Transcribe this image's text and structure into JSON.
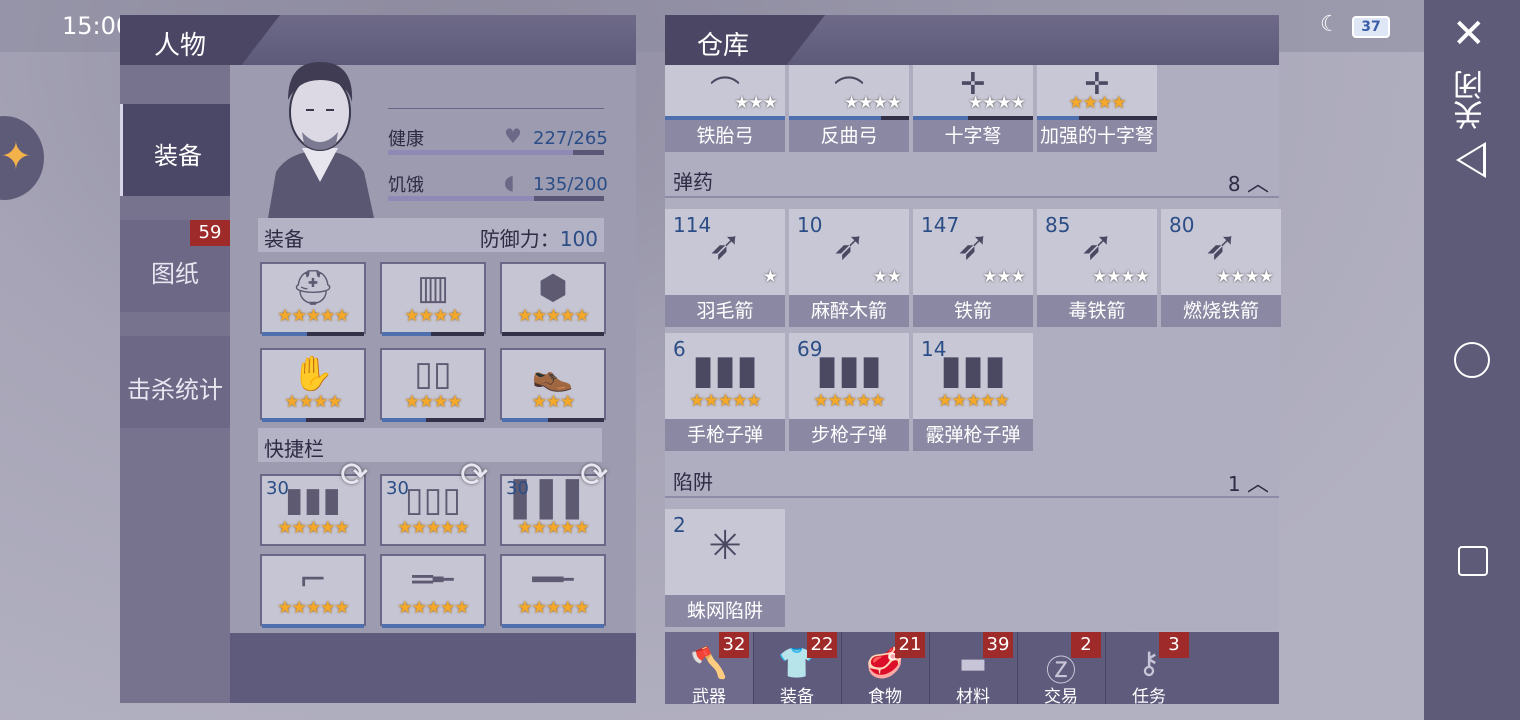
{
  "statusbar": {
    "time": "15:00",
    "battery": "37"
  },
  "system_rail": {
    "close_label": "关闭"
  },
  "left_header": {
    "title": "人物"
  },
  "right_header": {
    "title": "仓库"
  },
  "side_tabs": [
    {
      "label": "装备",
      "active": true
    },
    {
      "label": "图纸",
      "badge": "59"
    },
    {
      "label": "击杀统计"
    }
  ],
  "character": {
    "health_label": "健康",
    "health_value": "227/265",
    "health_fraction": 0.857,
    "hunger_label": "饥饿",
    "hunger_value": "135/200",
    "hunger_fraction": 0.675
  },
  "equipment": {
    "title": "装备",
    "defense_label": "防御力：",
    "defense_value": "100",
    "slots": [
      {
        "icon": "helmet-icon",
        "stars": "★★★★★",
        "durability": 0.44
      },
      {
        "icon": "chest-armor-icon",
        "stars": "★★★★",
        "durability": 0.48
      },
      {
        "icon": "turtle-shell-icon",
        "stars": "★★★★★",
        "durability": 0.0
      },
      {
        "icon": "gloves-icon",
        "stars": "★★★★",
        "durability": 0.43
      },
      {
        "icon": "pants-icon",
        "stars": "★★★★",
        "durability": 0.43
      },
      {
        "icon": "boots-icon",
        "stars": "★★★",
        "durability": 0.45
      }
    ]
  },
  "quickbar": {
    "title": "快捷栏",
    "slots": [
      {
        "icon": "pistol-ammo-icon",
        "qty": "30",
        "stars": "★★★★★"
      },
      {
        "icon": "shotgun-shells-icon",
        "qty": "30",
        "stars": "★★★★★"
      },
      {
        "icon": "rifle-ammo-icon",
        "qty": "30",
        "stars": "★★★★★"
      },
      {
        "icon": "revolver-icon",
        "stars": "★★★★★",
        "durability": 1.0
      },
      {
        "icon": "shotgun-icon",
        "stars": "★★★★★",
        "durability": 1.0
      },
      {
        "icon": "rifle-icon",
        "stars": "★★★★★",
        "durability": 1.0
      }
    ]
  },
  "warehouse": {
    "weapons": [
      {
        "name": "铁胎弓",
        "stars": "★★★",
        "gold": false,
        "durability": 1.0
      },
      {
        "name": "反曲弓",
        "stars": "★★★★",
        "gold": false,
        "durability": 0.77
      },
      {
        "name": "十字弩",
        "stars": "★★★★",
        "gold": false,
        "durability": 0.46
      },
      {
        "name": "加强的十字弩",
        "stars": "★★★★",
        "gold": true,
        "durability": 0.35
      }
    ],
    "ammo_section": {
      "title": "弹药",
      "count": "8"
    },
    "ammo": [
      {
        "name": "羽毛箭",
        "qty": "114",
        "stars": "★",
        "gold": false
      },
      {
        "name": "麻醉木箭",
        "qty": "10",
        "stars": "★★",
        "gold": false
      },
      {
        "name": "铁箭",
        "qty": "147",
        "stars": "★★★",
        "gold": false
      },
      {
        "name": "毒铁箭",
        "qty": "85",
        "stars": "★★★★",
        "gold": false
      },
      {
        "name": "燃烧铁箭",
        "qty": "80",
        "stars": "★★★★",
        "gold": false
      },
      {
        "name": "手枪子弹",
        "qty": "6",
        "stars": "★★★★★",
        "gold": true
      },
      {
        "name": "步枪子弹",
        "qty": "69",
        "stars": "★★★★★",
        "gold": true
      },
      {
        "name": "霰弹枪子弹",
        "qty": "14",
        "stars": "★★★★★",
        "gold": true
      }
    ],
    "trap_section": {
      "title": "陷阱",
      "count": "1"
    },
    "traps": [
      {
        "name": "蛛网陷阱",
        "qty": "2"
      }
    ]
  },
  "bottom_tabs": [
    {
      "label": "武器",
      "badge": "32",
      "icon": "axe-icon"
    },
    {
      "label": "装备",
      "badge": "22",
      "icon": "shirt-icon"
    },
    {
      "label": "食物",
      "badge": "21",
      "icon": "meat-icon"
    },
    {
      "label": "材料",
      "badge": "39",
      "icon": "wood-log-icon"
    },
    {
      "label": "交易",
      "badge": "2",
      "icon": "coin-icon"
    },
    {
      "label": "任务",
      "badge": "3",
      "icon": "key-icon"
    }
  ]
}
